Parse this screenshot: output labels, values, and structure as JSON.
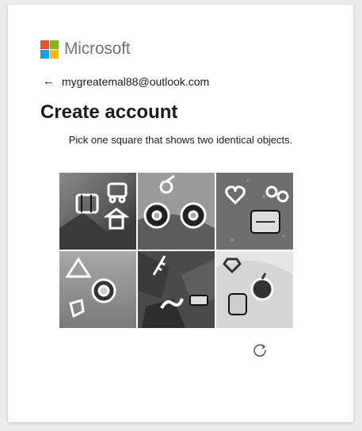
{
  "brand": {
    "name": "Microsoft",
    "logo_colors": [
      "#f25022",
      "#7fba00",
      "#00a4ef",
      "#ffb900"
    ]
  },
  "identity": {
    "back_icon": "arrow-left-icon",
    "email": "mygreatemal88@outlook.com"
  },
  "page": {
    "title": "Create account",
    "instruction": "Pick one square that shows two identical objects."
  },
  "captcha": {
    "tiles": [
      {
        "icons": [
          "pagoda-icon",
          "binder-icon",
          "train-icon"
        ]
      },
      {
        "icons": [
          "cherry-icon",
          "donut-icon",
          "donut-icon"
        ]
      },
      {
        "icons": [
          "heart-icon",
          "glasses-icon",
          "cat-icon"
        ]
      },
      {
        "icons": [
          "tent-icon",
          "lion-icon",
          "shield-icon"
        ]
      },
      {
        "icons": [
          "wheat-icon",
          "snake-icon",
          "tower-icon"
        ]
      },
      {
        "icons": [
          "gem-icon",
          "apple-icon",
          "cat-icon"
        ]
      }
    ],
    "refresh_icon": "refresh-icon"
  }
}
